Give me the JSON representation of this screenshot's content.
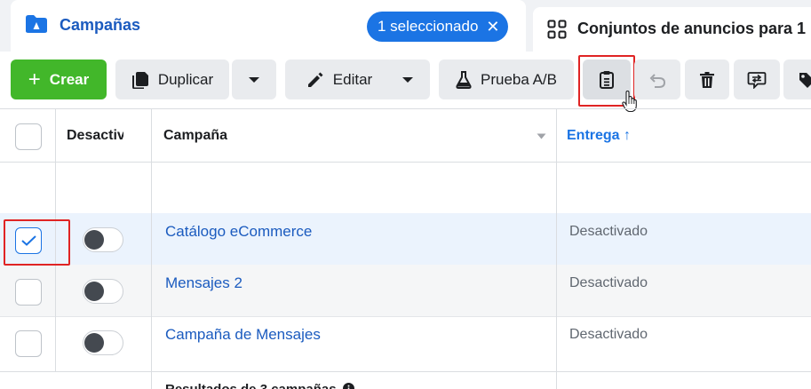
{
  "tabs": {
    "active": {
      "title": "Campañas",
      "badge": "1 seleccionado",
      "badge_close": "✕"
    },
    "other": {
      "title": "Conjuntos de anuncios para 1"
    }
  },
  "toolbar": {
    "create_label": "Crear",
    "create_plus": "+",
    "duplicate_label": "Duplicar",
    "edit_label": "Editar",
    "ab_test_label": "Prueba A/B"
  },
  "table": {
    "columns": {
      "toggle": "Desactivado",
      "campaign": "Campaña",
      "delivery": "Entrega",
      "delivery_sort": "↑"
    },
    "rows": [
      {
        "name": "Catálogo eCommerce",
        "status": "Desactivado",
        "selected": true
      },
      {
        "name": "Mensajes 2",
        "status": "Desactivado",
        "selected": false
      },
      {
        "name": "Campaña de Mensajes",
        "status": "Desactivado",
        "selected": false
      }
    ],
    "footer": "Resultados de 3 campañas"
  },
  "colors": {
    "accent": "#1b74e4",
    "link": "#1b5bbf",
    "create": "#42b72a",
    "highlight": "#e02424"
  }
}
